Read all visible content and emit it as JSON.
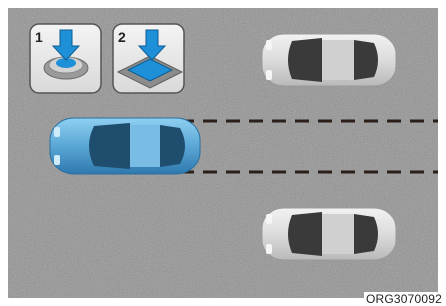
{
  "illustration": {
    "steps": [
      {
        "number": "1",
        "icon": "press-button-icon"
      },
      {
        "number": "2",
        "icon": "press-switch-icon"
      }
    ],
    "vehicles": [
      {
        "role": "own-vehicle",
        "color": "#5aa7d6"
      },
      {
        "role": "parked-vehicle-top",
        "color": "#e3e3e3"
      },
      {
        "role": "parked-vehicle-bottom",
        "color": "#e3e3e3"
      }
    ],
    "parking_space_lines": "dashed",
    "code": "ORG3070092"
  },
  "colors": {
    "road": "#8d8d8d",
    "accent": "#1e90d8",
    "line": "#2b1f19"
  }
}
